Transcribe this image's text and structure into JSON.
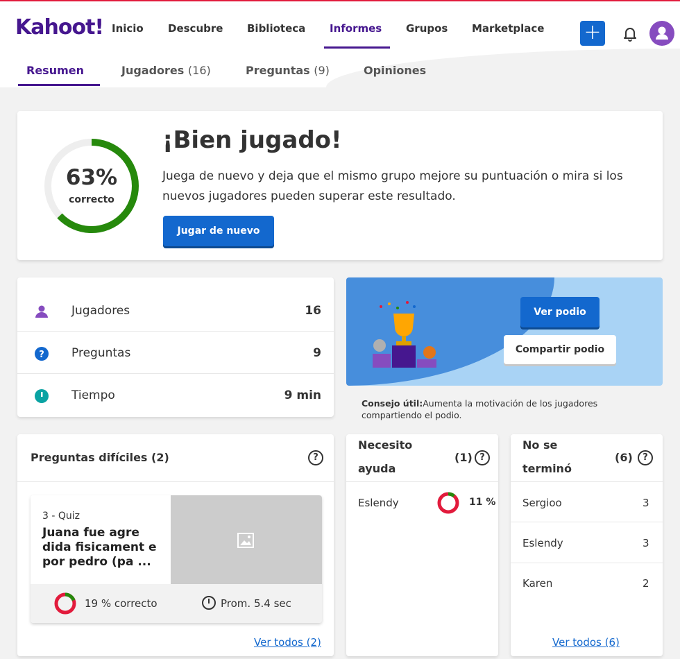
{
  "header": {
    "logo": "Kahoot!",
    "nav": [
      "Inicio",
      "Descubre",
      "Biblioteca",
      "Informes",
      "Grupos",
      "Marketplace"
    ],
    "active_nav": "Informes",
    "plus_label": "+"
  },
  "tabs": {
    "resumen": "Resumen",
    "jugadores": "Jugadores",
    "jugadores_count": "(16)",
    "preguntas": "Preguntas",
    "preguntas_count": "(9)",
    "opiniones": "Opiniones"
  },
  "summary": {
    "percent": "63%",
    "percent_value": 0.63,
    "percent_label": "correcto",
    "title": "¡Bien jugado!",
    "text": "Juega de nuevo y deja que el mismo grupo mejore su puntuación o mira si los nuevos jugadores pueden superar este resultado.",
    "button": "Jugar de nuevo"
  },
  "stats": [
    {
      "icon": "user-icon",
      "label": "Jugadores",
      "value": "16"
    },
    {
      "icon": "question-icon",
      "label": "Preguntas",
      "value": "9"
    },
    {
      "icon": "clock-icon",
      "label": "Tiempo",
      "value": "9 min"
    }
  ],
  "podium": {
    "view_button": "Ver podio",
    "share_button": "Compartir podio",
    "tip_label": "Consejo útil:",
    "tip_text": "Aumenta la motivación de los jugadores compartiendo el podio."
  },
  "difficult": {
    "title": "Preguntas difíciles (2)",
    "question_type": "3 - Quiz",
    "question_text": "Juana fue agre dida fisicament e por pedro (pa ...",
    "correct": "19 % correcto",
    "correct_value": 0.19,
    "avg": "Prom. 5.4 sec",
    "link": "Ver todos (2)"
  },
  "help": {
    "title_line1": "Necesito",
    "title_line2": "ayuda",
    "count": "(1)",
    "player": "Eslendy",
    "percent": "11 %",
    "percent_value": 0.11
  },
  "unfinished": {
    "title_line1": "No se",
    "title_line2": "terminó",
    "count": "(6)",
    "players": [
      {
        "name": "Sergioo",
        "value": "3"
      },
      {
        "name": "Eslendy",
        "value": "3"
      },
      {
        "name": "Karen",
        "value": "2"
      }
    ],
    "link": "Ver todos (6)"
  },
  "colors": {
    "brand": "#46178f",
    "blue": "#1368ce",
    "green": "#26890c",
    "red": "#e21b3c"
  }
}
